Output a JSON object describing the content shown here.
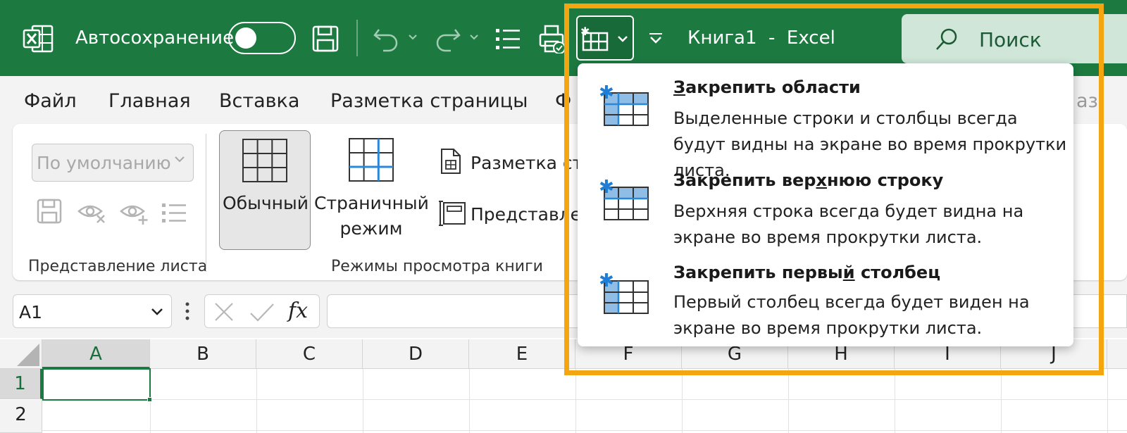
{
  "titlebar": {
    "autosave_label": "Автосохранение",
    "document_title": "Книга1  -  Excel",
    "search_label": "Поиск",
    "colors": {
      "bar": "#1c7a41",
      "highlight": "#f3a60f"
    }
  },
  "menu": {
    "tabs": [
      "Файл",
      "Главная",
      "Вставка",
      "Разметка страницы",
      "Ф",
      "аз"
    ]
  },
  "ribbon": {
    "sheet_view_select": "По умолчанию",
    "sheet_view_group": "Представление листа",
    "workbook_views_group": "Режимы просмотра книги",
    "normal_label": "Обычный",
    "page_break_label_1": "Страничный",
    "page_break_label_2": "режим",
    "page_layout_label": "Разметка ст",
    "custom_views_label": "Представле"
  },
  "formula_bar": {
    "name_box": "A1",
    "fx": "fx"
  },
  "grid": {
    "columns": [
      "A",
      "B",
      "C",
      "D",
      "E",
      "F",
      "G",
      "H",
      "I",
      "J"
    ],
    "rows": [
      "1",
      "2"
    ],
    "active_cell": "A1"
  },
  "freeze_menu": {
    "items": [
      {
        "title_pre": "",
        "title_key": "З",
        "title_post": "акрепить области",
        "desc": "Выделенные строки и столбцы всегда будут видны на экране во время прокрутки листа."
      },
      {
        "title_pre": "Закрепить вер",
        "title_key": "х",
        "title_post": "нюю строку",
        "desc": "Верхняя строка всегда будет видна на экране во время прокрутки листа."
      },
      {
        "title_pre": "Закрепить первы",
        "title_key": "й",
        "title_post": " столбец",
        "desc": "Первый столбец всегда будет виден на экране во время прокрутки листа."
      }
    ]
  }
}
